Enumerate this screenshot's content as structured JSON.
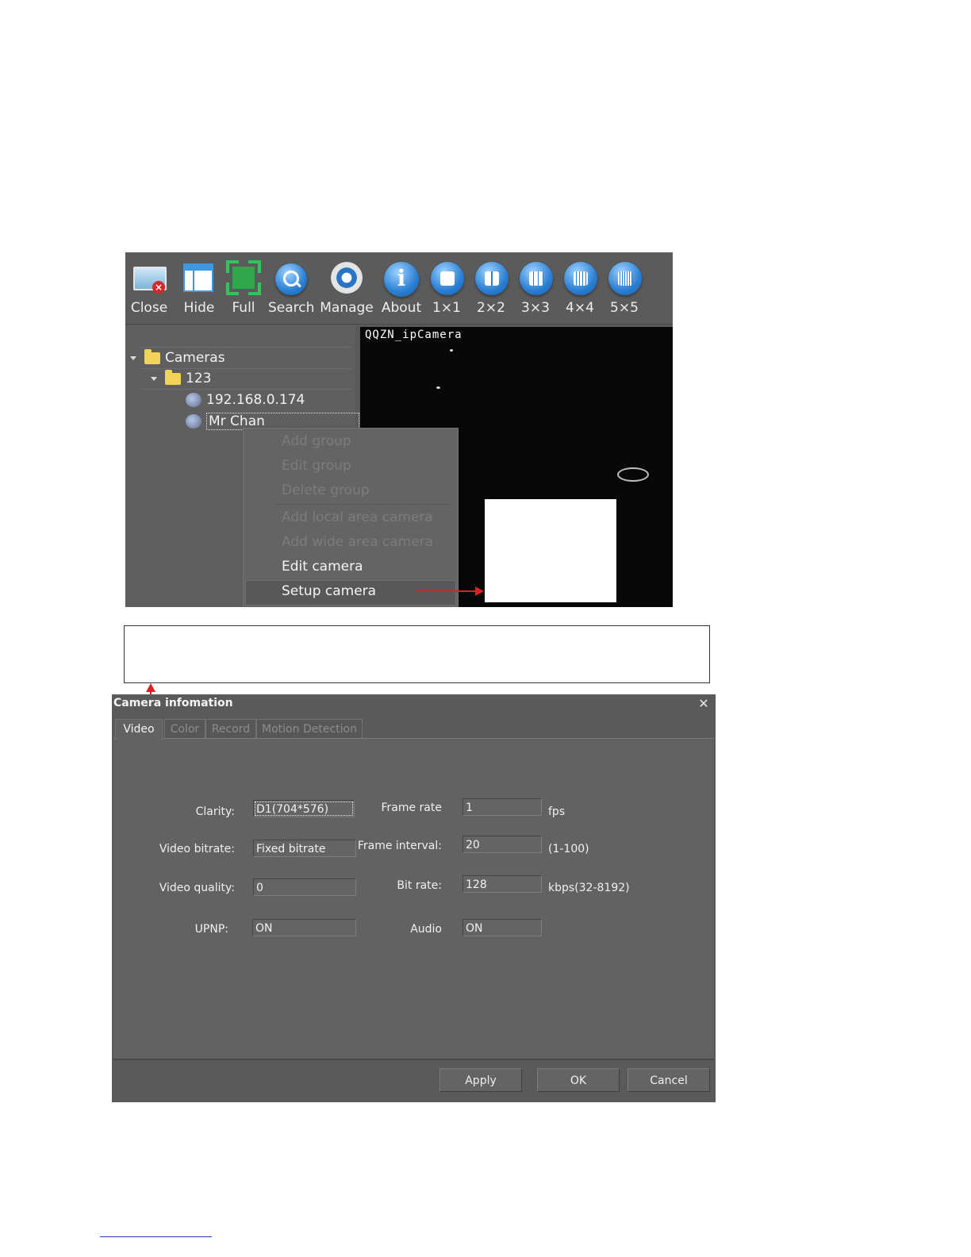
{
  "toolbar": {
    "buttons": [
      {
        "label": "Close"
      },
      {
        "label": "Hide"
      },
      {
        "label": "Full"
      },
      {
        "label": "Search"
      },
      {
        "label": "Manage"
      },
      {
        "label": "About"
      },
      {
        "label": "1×1"
      },
      {
        "label": "2×2"
      },
      {
        "label": "3×3"
      },
      {
        "label": "4×4"
      },
      {
        "label": "5×5"
      }
    ]
  },
  "tree": {
    "root": "Cameras",
    "group": "123",
    "cameras": [
      "192.168.0.174",
      "Mr Chan"
    ]
  },
  "video": {
    "overlay_text": "QQZN_ipCamera"
  },
  "context_menu": {
    "items": [
      {
        "label": "Add group",
        "enabled": false
      },
      {
        "label": "Edit group",
        "enabled": false
      },
      {
        "label": "Delete group",
        "enabled": false
      },
      {
        "label": "Add local area camera",
        "enabled": false
      },
      {
        "label": "Add wide area camera",
        "enabled": false
      },
      {
        "label": "Edit camera",
        "enabled": true
      },
      {
        "label": "Setup camera",
        "enabled": true,
        "highlighted": true
      }
    ]
  },
  "dialog": {
    "title": "Camera infomation",
    "close_glyph": "✕",
    "tabs": [
      {
        "label": "Video",
        "active": true
      },
      {
        "label": "Color",
        "active": false
      },
      {
        "label": "Record",
        "active": false
      },
      {
        "label": "Motion Detection",
        "active": false
      }
    ],
    "fields": {
      "clarity": {
        "label": "Clarity:",
        "value": "D1(704*576)"
      },
      "video_bitrate": {
        "label": "Video bitrate:",
        "value": "Fixed bitrate"
      },
      "video_quality": {
        "label": "Video quality:",
        "value": "0"
      },
      "upnp": {
        "label": "UPNP:",
        "value": "ON"
      },
      "frame_rate": {
        "label": "Frame rate",
        "value": "1",
        "unit": "fps"
      },
      "frame_interval": {
        "label": "Frame interval:",
        "value": "20",
        "unit": "(1-100)"
      },
      "bit_rate": {
        "label": "Bit rate:",
        "value": "128",
        "unit": "kbps(32-8192)"
      },
      "audio": {
        "label": "Audio",
        "value": "ON"
      }
    },
    "buttons": {
      "apply": "Apply",
      "ok": "OK",
      "cancel": "Cancel"
    }
  },
  "colors": {
    "toolbar_bg": "#5b5b5b",
    "panel_bg": "#5f5f5f",
    "dialog_bg": "#5a5a5a",
    "annotation_arrow": "#e02020",
    "link_underline": "#1a3cc8"
  }
}
